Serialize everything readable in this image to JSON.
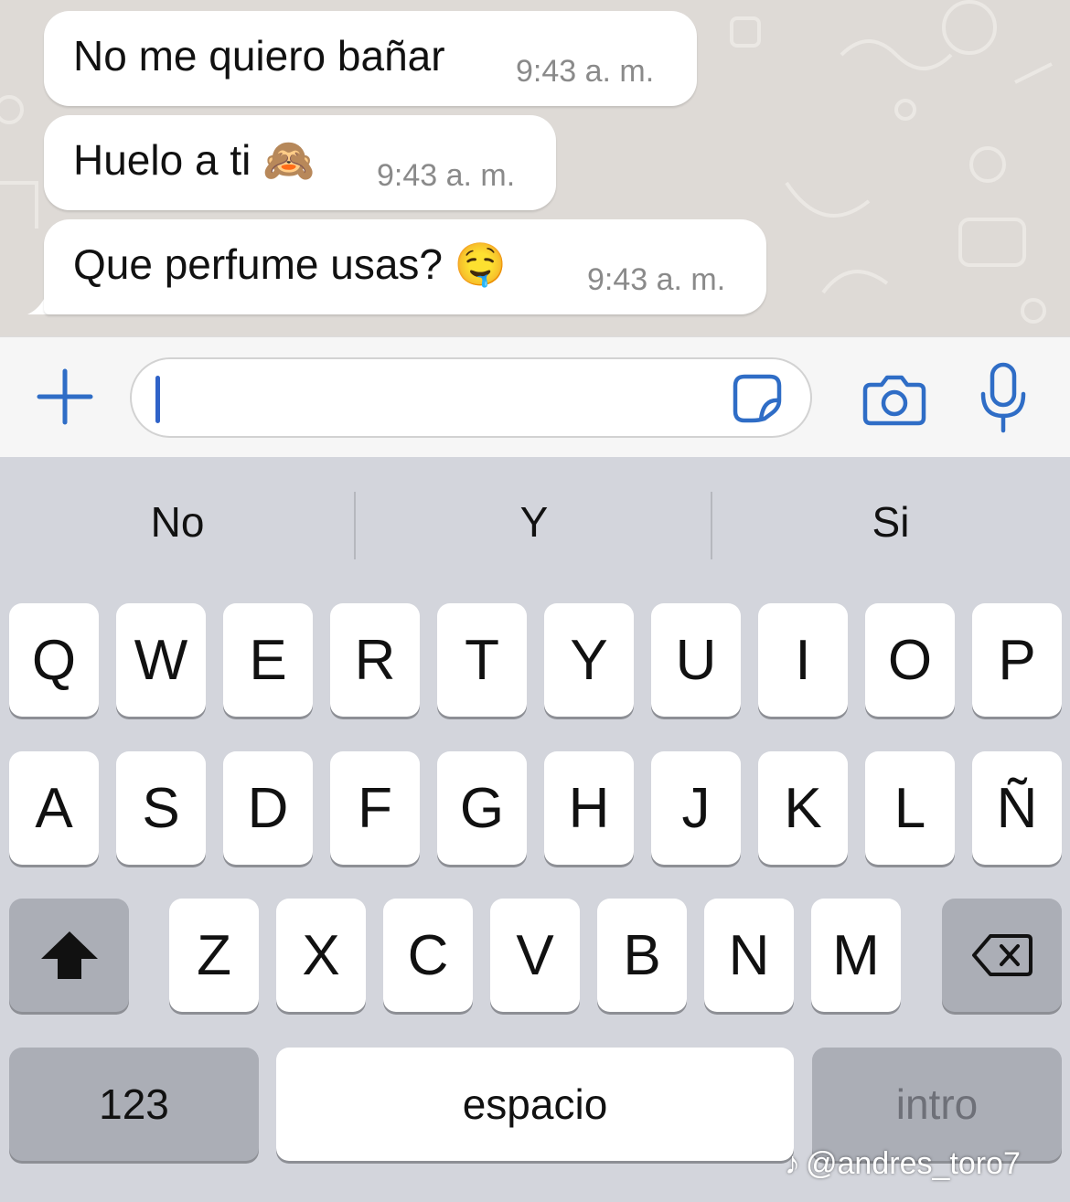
{
  "chat": {
    "messages": [
      {
        "text": "No me quiero bañar",
        "time": "9:43 a. m."
      },
      {
        "text": "Huelo a ti 🙈",
        "time": "9:43 a. m."
      },
      {
        "text": "Que perfume usas? 🤤",
        "time": "9:43 a. m."
      }
    ]
  },
  "composer": {
    "value": "",
    "icons": {
      "attach": "plus-icon",
      "sticker": "sticker-icon",
      "camera": "camera-icon",
      "mic": "microphone-icon"
    },
    "accent_color": "#2f6dc6"
  },
  "keyboard": {
    "suggestions": [
      "No",
      "Y",
      "Si"
    ],
    "row1": [
      "Q",
      "W",
      "E",
      "R",
      "T",
      "Y",
      "U",
      "I",
      "O",
      "P"
    ],
    "row2": [
      "A",
      "S",
      "D",
      "F",
      "G",
      "H",
      "J",
      "K",
      "L",
      "Ñ"
    ],
    "row3": [
      "Z",
      "X",
      "C",
      "V",
      "B",
      "N",
      "M"
    ],
    "numbers_label": "123",
    "space_label": "espacio",
    "return_label": "intro",
    "shift_icon": "shift-arrow-icon",
    "delete_icon": "backspace-icon"
  },
  "watermark": {
    "text": "@andres_toro7"
  }
}
